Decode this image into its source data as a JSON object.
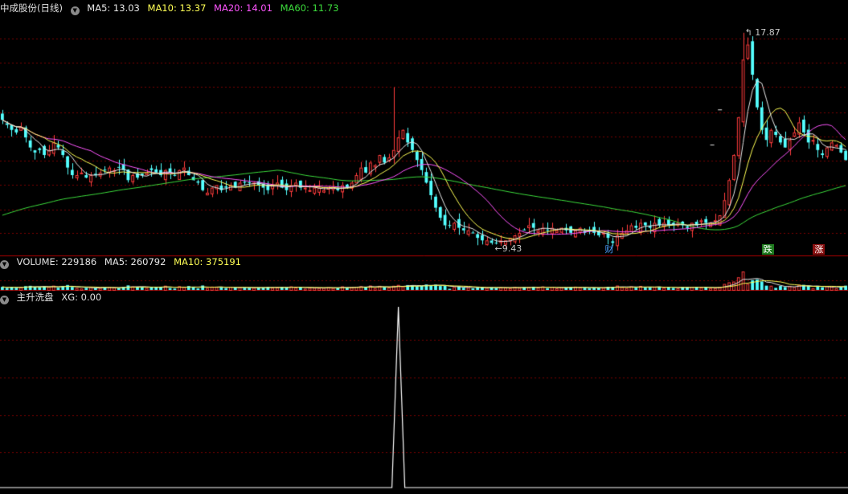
{
  "colors": {
    "up": "#ff3c3c",
    "down": "#54ffff",
    "ma5": "#e8e8e8",
    "ma10": "#ffff55",
    "ma20": "#ff55ff",
    "ma60": "#3cdc3c",
    "grid": "#7a0000",
    "frame": "#b00000",
    "signal": "#ffffff"
  },
  "price_panel": {
    "stock_name": "中成股份(日线)",
    "ma5_label": "MA5: 13.03",
    "ma10_label": "MA10: 13.37",
    "ma20_label": "MA20: 14.01",
    "ma60_label": "MA60: 11.73",
    "high_label": "17.87",
    "low_label": "9.43",
    "events": [
      {
        "id": "cai",
        "label": "财",
        "index": 130
      },
      {
        "id": "die",
        "label": "跌",
        "index": 164
      },
      {
        "id": "zhang",
        "label": "涨",
        "index": 175
      }
    ]
  },
  "volume_panel": {
    "vol_label": "VOLUME: 229186",
    "ma5_label": "MA5: 260792",
    "ma10_label": "MA10: 375191"
  },
  "indicator_panel": {
    "title": "主升洗盘",
    "xg_label": "XG: 0.00"
  },
  "chart_data": {
    "type": "candlestick",
    "closes": [
      14.4,
      14.2,
      14.0,
      13.9,
      14.1,
      13.7,
      13.3,
      13.1,
      13.2,
      13.0,
      13.2,
      13.5,
      13.3,
      13.0,
      12.5,
      12.2,
      12.2,
      12.3,
      12.1,
      12.2,
      12.2,
      12.3,
      12.4,
      12.5,
      12.4,
      12.5,
      12.4,
      12.0,
      12.2,
      12.1,
      12.2,
      12.3,
      12.4,
      12.3,
      12.2,
      12.4,
      12.3,
      12.2,
      12.4,
      12.5,
      12.2,
      12.0,
      11.9,
      11.6,
      11.5,
      11.7,
      11.8,
      11.6,
      11.7,
      11.8,
      11.7,
      11.9,
      11.9,
      11.9,
      11.9,
      11.8,
      11.7,
      11.6,
      11.8,
      11.9,
      11.7,
      11.6,
      11.8,
      11.9,
      11.7,
      11.7,
      11.6,
      11.7,
      11.7,
      11.6,
      11.7,
      11.7,
      11.6,
      11.8,
      11.7,
      11.9,
      12.2,
      12.5,
      12.3,
      12.7,
      12.6,
      13.0,
      12.7,
      12.9,
      13.2,
      13.7,
      14.0,
      13.5,
      13.2,
      12.8,
      12.4,
      11.9,
      11.4,
      10.9,
      10.5,
      10.2,
      10.2,
      10.3,
      10.1,
      10.0,
      10.0,
      9.9,
      9.7,
      9.6,
      9.6,
      9.5,
      9.5,
      9.6,
      9.6,
      9.7,
      9.8,
      9.9,
      10.0,
      10.2,
      10.1,
      10.0,
      10.1,
      10.0,
      10.1,
      10.0,
      10.1,
      10.0,
      9.9,
      10.0,
      10.1,
      9.9,
      10.0,
      9.9,
      9.8,
      9.9,
      9.7,
      9.5,
      9.8,
      9.9,
      10.0,
      10.2,
      10.1,
      10.3,
      10.2,
      10.1,
      10.3,
      10.2,
      10.3,
      10.2,
      10.2,
      10.3,
      10.2,
      10.1,
      10.3,
      10.2,
      10.4,
      10.3,
      10.3,
      10.4,
      10.6,
      11.2,
      12.0,
      13.0,
      14.5,
      16.8,
      17.4,
      16.2,
      14.9,
      14.0,
      13.6,
      14.0,
      13.8,
      13.5,
      13.3,
      13.6,
      13.9,
      14.3,
      13.9,
      13.5,
      13.6,
      13.2,
      13.0,
      13.3,
      13.5,
      13.4,
      13.1,
      12.8
    ],
    "ma5_last": 13.03,
    "ma10_last": 13.37,
    "ma20_last": 14.01,
    "ma60_last": 11.73,
    "high": 17.87,
    "low": 9.43,
    "volume_last": 229186,
    "volume_ma5_last": 260792,
    "volume_ma10_last": 375191,
    "xg_last": 0.0,
    "xg_spike_index": 85,
    "xg_spike_value": 1
  }
}
